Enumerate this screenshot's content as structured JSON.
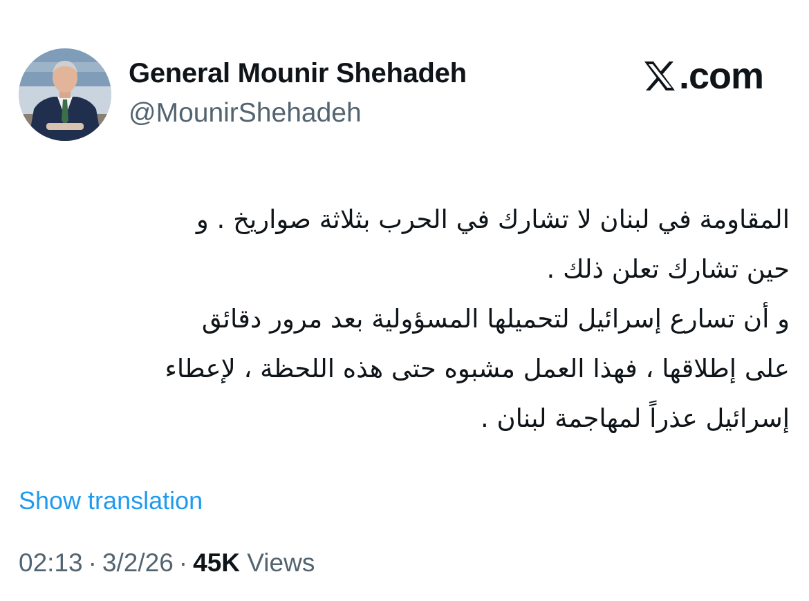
{
  "author": {
    "display_name": "General Mounir Shehadeh",
    "handle": "@MounirShehadeh",
    "avatar_icon": "profile-photo-man-in-suit"
  },
  "brand": {
    "icon": "x-logo-icon",
    "text": ".com"
  },
  "tweet": {
    "lines": [
      "المقاومة في لبنان لا تشارك في الحرب بثلاثة صواريخ . و",
      "حين تشارك تعلن ذلك .",
      "و أن تسارع إسرائيل لتحميلها المسؤولية بعد مرور دقائق",
      "على إطلاقها ، فهذا العمل مشبوه حتى هذه اللحظة ، لإعطاء",
      "إسرائيل عذراً لمهاجمة لبنان ."
    ]
  },
  "translate_label": "Show translation",
  "meta": {
    "time": "02:13",
    "separator": "·",
    "date": "3/2/26",
    "views_count": "45K",
    "views_label": "Views"
  },
  "colors": {
    "link": "#1d9bf0",
    "secondary_text": "#536471",
    "primary_text": "#0f1419",
    "background": "#ffffff"
  }
}
